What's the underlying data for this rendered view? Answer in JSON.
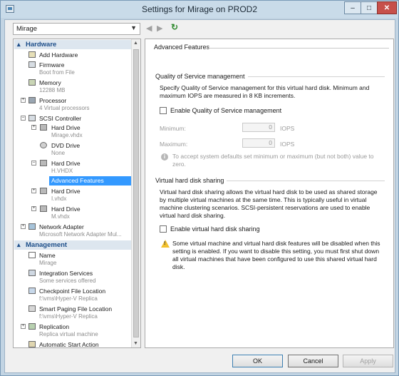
{
  "window": {
    "title": "Settings for Mirage on PROD2",
    "minimize_label": "–",
    "maximize_label": "□",
    "close_label": "✕"
  },
  "vm_selector": {
    "value": "Mirage"
  },
  "toolbar": {
    "back": "◀",
    "forward": "▶",
    "refresh": "↻"
  },
  "tree": {
    "hardware_header": "Hardware",
    "management_header": "Management",
    "hardware_items": [
      {
        "label": "Add Hardware",
        "sub": ""
      },
      {
        "label": "Firmware",
        "sub": "Boot from File"
      },
      {
        "label": "Memory",
        "sub": "12288 MB"
      },
      {
        "label": "Processor",
        "sub": "4 Virtual processors"
      },
      {
        "label": "SCSI Controller",
        "sub": ""
      },
      {
        "label": "Hard Drive",
        "sub": "Mirage.vhdx"
      },
      {
        "label": "DVD Drive",
        "sub": "None"
      },
      {
        "label": "Hard Drive",
        "sub": "H.VHDX"
      },
      {
        "label": "Advanced Features",
        "sub": ""
      },
      {
        "label": "Hard Drive",
        "sub": "I.vhdx"
      },
      {
        "label": "Hard Drive",
        "sub": "M.vhdx"
      },
      {
        "label": "Network Adapter",
        "sub": "Microsoft Network Adapter Mul..."
      }
    ],
    "management_items": [
      {
        "label": "Name",
        "sub": "Mirage"
      },
      {
        "label": "Integration Services",
        "sub": "Some services offered"
      },
      {
        "label": "Checkpoint File Location",
        "sub": "f:\\vms\\Hyper-V Replica"
      },
      {
        "label": "Smart Paging File Location",
        "sub": "f:\\vms\\Hyper-V Replica"
      },
      {
        "label": "Replication",
        "sub": "Replica virtual machine"
      },
      {
        "label": "Automatic Start Action",
        "sub": ""
      }
    ]
  },
  "panel": {
    "title": "Advanced Features",
    "qos": {
      "title": "Quality of Service management",
      "description": "Specify Quality of Service management for this virtual hard disk. Minimum and maximum IOPS are measured in 8 KB increments.",
      "checkbox_label": "Enable Quality of Service management",
      "checkbox_checked": false,
      "minimum_label": "Minimum:",
      "minimum_value": "0",
      "maximum_label": "Maximum:",
      "maximum_value": "0",
      "unit": "IOPS",
      "info_text": "To accept system defaults set minimum or maximum (but not both) value to zero."
    },
    "sharing": {
      "title": "Virtual hard disk sharing",
      "description": "Virtual hard disk sharing allows the virtual hard disk to be used as shared storage by multiple virtual machines at the same time. This is typically useful in virtual machine clustering scenarios. SCSI-persistent reservations are used to enable virtual hard disk sharing.",
      "checkbox_label": "Enable virtual hard disk sharing",
      "checkbox_checked": false,
      "warning_text": "Some virtual machine and virtual hard disk features will be disabled when this setting is enabled. If you want to disable this setting, you must first shut down all virtual machines that have been configured to use this shared virtual hard disk."
    }
  },
  "buttons": {
    "ok": "OK",
    "cancel": "Cancel",
    "apply": "Apply"
  }
}
